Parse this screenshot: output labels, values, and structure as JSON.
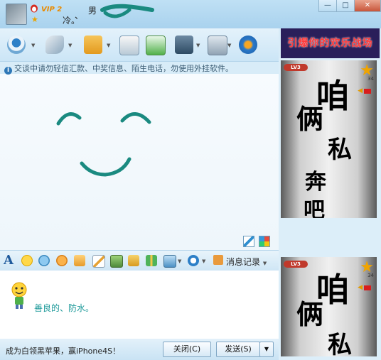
{
  "titlebar": {
    "vip_label": "VIP 2",
    "dot": "、",
    "nick_cold": "冷。",
    "nick_male": "男"
  },
  "ad": {
    "text": "引爆你的欢乐战场"
  },
  "notice": {
    "text": "交谈中请勿轻信汇款、中奖信息、陌生电话，勿使用外挂软件。"
  },
  "format_toolbar": {
    "history_label": "消息记录"
  },
  "input": {
    "text": "善良的、防水。"
  },
  "bottom": {
    "promo_text": "成为白领黑苹果，赢iPhone4S！",
    "close_label": "关闭(C)",
    "send_label": "发送(S)"
  },
  "video1": {
    "level": "LV3",
    "count": "34",
    "chars": [
      "咱",
      "俩",
      "私",
      "奔",
      "吧"
    ]
  },
  "video2": {
    "level": "LV3",
    "count": "34",
    "chars": [
      "咱",
      "俩",
      "私"
    ]
  },
  "colors": {
    "smile_stroke": "#1a8a80",
    "input_text": "#1e9a9a",
    "accent": "#2f78b7"
  }
}
